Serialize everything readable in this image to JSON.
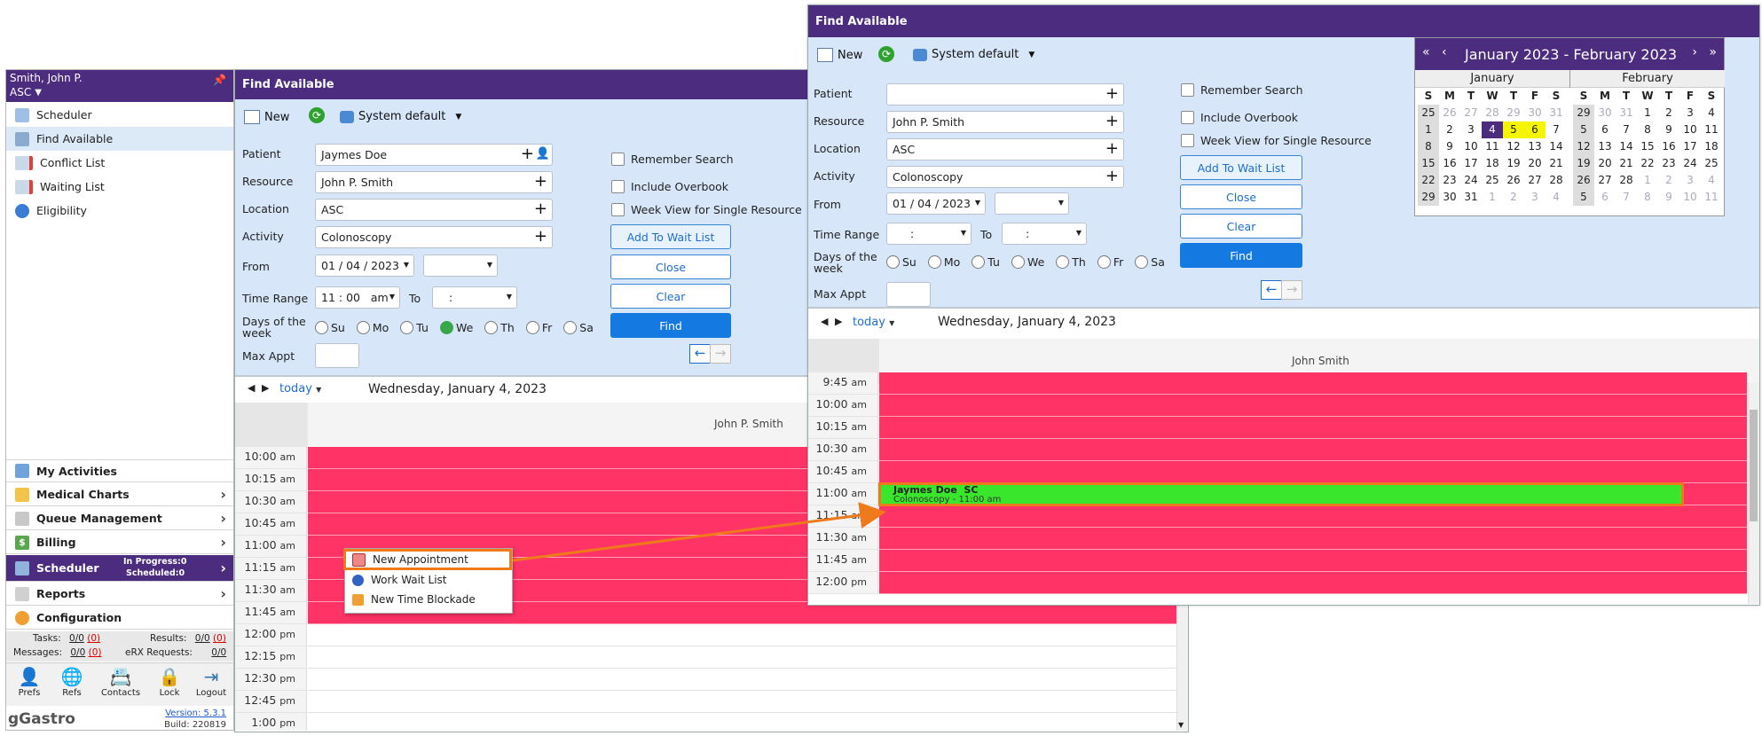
{
  "sidebar": {
    "user_name": "Smith, John P.",
    "facility": "ASC",
    "nav": [
      "Scheduler",
      "Find Available",
      "Conflict List",
      "Waiting List",
      "Eligibility"
    ],
    "modules": [
      {
        "label": "My Activities",
        "has_chevron": false
      },
      {
        "label": "Medical Charts",
        "has_chevron": true
      },
      {
        "label": "Queue Management",
        "has_chevron": true
      },
      {
        "label": "Billing",
        "has_chevron": true
      },
      {
        "label": "Scheduler",
        "has_chevron": true,
        "in_progress": "In Progress:0",
        "scheduled": "Scheduled:0"
      },
      {
        "label": "Reports",
        "has_chevron": true
      },
      {
        "label": "Configuration",
        "has_chevron": false
      }
    ],
    "stats": {
      "tasks_label": "Tasks:",
      "tasks_value": "0/0",
      "tasks_red": "(0)",
      "results_label": "Results:",
      "results_value": "0/0",
      "results_red": "(0)",
      "messages_label": "Messages:",
      "messages_value": "0/0",
      "messages_red": "(0)",
      "erx_label": "eRX Requests:",
      "erx_value": "0/0"
    },
    "footer_buttons": [
      "Prefs",
      "Refs",
      "Contacts",
      "Lock",
      "Logout"
    ],
    "brand": "gGastro",
    "version": "Version: 5.3.1",
    "build": "Build: 220819"
  },
  "left_window": {
    "title": "Find Available",
    "toolbar": {
      "new": "New",
      "system_default": "System default"
    },
    "labels": {
      "patient": "Patient",
      "resource": "Resource",
      "location": "Location",
      "activity": "Activity",
      "from": "From",
      "time_range": "Time Range",
      "to": "To",
      "days_line1": "Days of the",
      "days_line2": "week",
      "max_appt": "Max Appt"
    },
    "values": {
      "patient": "Jaymes Doe",
      "resource": "John P. Smith",
      "location": "ASC",
      "activity": "Colonoscopy",
      "from_date": "01 / 04 / 2023",
      "time_from": "11 : 00   am",
      "time_to": ":"
    },
    "checks": [
      "Remember Search",
      "Include Overbook",
      "Week View for Single Resource"
    ],
    "buttons": {
      "wait_list": "Add To Wait List",
      "close": "Close",
      "clear": "Clear",
      "find": "Find"
    },
    "days": [
      "Su",
      "Mo",
      "Tu",
      "We",
      "Th",
      "Fr",
      "Sa"
    ],
    "checked_day": "We",
    "cal_nav": {
      "today": "today",
      "date": "Wednesday, January 4, 2023"
    },
    "resource_col": "John P. Smith",
    "times": [
      {
        "t": "10:00",
        "ap": "am",
        "busy": true
      },
      {
        "t": "10:15",
        "ap": "am",
        "busy": true
      },
      {
        "t": "10:30",
        "ap": "am",
        "busy": true
      },
      {
        "t": "10:45",
        "ap": "am",
        "busy": true
      },
      {
        "t": "11:00",
        "ap": "am",
        "busy": true
      },
      {
        "t": "11:15",
        "ap": "am",
        "busy": true
      },
      {
        "t": "11:30",
        "ap": "am",
        "busy": true
      },
      {
        "t": "11:45",
        "ap": "am",
        "busy": true
      },
      {
        "t": "12:00",
        "ap": "pm",
        "busy": false
      },
      {
        "t": "12:15",
        "ap": "pm",
        "busy": false
      },
      {
        "t": "12:30",
        "ap": "pm",
        "busy": false
      },
      {
        "t": "12:45",
        "ap": "pm",
        "busy": false
      },
      {
        "t": "1:00",
        "ap": "pm",
        "busy": false
      }
    ],
    "context_menu": [
      "New Appointment",
      "Work Wait List",
      "New Time Blockade"
    ]
  },
  "right_window": {
    "title": "Find Available",
    "toolbar": {
      "new": "New",
      "system_default": "System default"
    },
    "labels": {
      "patient": "Patient",
      "resource": "Resource",
      "location": "Location",
      "activity": "Activity",
      "from": "From",
      "time_range": "Time Range",
      "to": "To",
      "days_line1": "Days of the",
      "days_line2": "week",
      "max_appt": "Max Appt"
    },
    "values": {
      "patient": "",
      "resource": "John P. Smith",
      "location": "ASC",
      "activity": "Colonoscopy",
      "from_date": "01 / 04 / 2023",
      "time_from": ":",
      "time_to": ":"
    },
    "checks": [
      "Remember Search",
      "Include Overbook",
      "Week View for Single Resource"
    ],
    "buttons": {
      "wait_list": "Add To Wait List",
      "close": "Close",
      "clear": "Clear",
      "find": "Find"
    },
    "days": [
      "Su",
      "Mo",
      "Tu",
      "We",
      "Th",
      "Fr",
      "Sa"
    ],
    "cal_nav": {
      "today": "today",
      "date": "Wednesday, January 4, 2023"
    },
    "resource_col": "John Smith",
    "times": [
      {
        "t": "9:45",
        "ap": "am"
      },
      {
        "t": "10:00",
        "ap": "am"
      },
      {
        "t": "10:15",
        "ap": "am"
      },
      {
        "t": "10:30",
        "ap": "am"
      },
      {
        "t": "10:45",
        "ap": "am"
      },
      {
        "t": "11:00",
        "ap": "am"
      },
      {
        "t": "11:15",
        "ap": "am"
      },
      {
        "t": "11:30",
        "ap": "am"
      },
      {
        "t": "11:45",
        "ap": "am"
      },
      {
        "t": "12:00",
        "ap": "pm"
      }
    ],
    "appointment": {
      "name": "Jaymes Doe  SC",
      "detail": "Colonoscopy - 11:00 am"
    },
    "mini_calendar": {
      "range_title": "January 2023 - February 2023",
      "weekday_headers": [
        "S",
        "M",
        "T",
        "W",
        "T",
        "F",
        "S"
      ],
      "months": [
        {
          "name": "January",
          "weeks": [
            {
              "wk": "25",
              "days": [
                "26",
                "27",
                "28",
                "29",
                "30",
                "31"
              ]
            },
            {
              "wk": "1",
              "days": [
                "2",
                "3",
                "4",
                "5",
                "6",
                "7"
              ]
            },
            {
              "wk": "8",
              "days": [
                "9",
                "10",
                "11",
                "12",
                "13",
                "14"
              ]
            },
            {
              "wk": "15",
              "days": [
                "16",
                "17",
                "18",
                "19",
                "20",
                "21"
              ]
            },
            {
              "wk": "22",
              "days": [
                "23",
                "24",
                "25",
                "26",
                "27",
                "28"
              ]
            },
            {
              "wk": "29",
              "days": [
                "30",
                "31",
                "1",
                "2",
                "3",
                "4"
              ]
            }
          ]
        },
        {
          "name": "February",
          "weeks": [
            {
              "wk": "29",
              "days": [
                "30",
                "31",
                "1",
                "2",
                "3",
                "4"
              ]
            },
            {
              "wk": "5",
              "days": [
                "6",
                "7",
                "8",
                "9",
                "10",
                "11"
              ]
            },
            {
              "wk": "12",
              "days": [
                "13",
                "14",
                "15",
                "16",
                "17",
                "18"
              ]
            },
            {
              "wk": "19",
              "days": [
                "20",
                "21",
                "22",
                "23",
                "24",
                "25"
              ]
            },
            {
              "wk": "26",
              "days": [
                "27",
                "28",
                "1",
                "2",
                "3",
                "4"
              ]
            },
            {
              "wk": "5",
              "days": [
                "6",
                "7",
                "8",
                "9",
                "10",
                "11"
              ]
            }
          ]
        }
      ]
    }
  },
  "colors": {
    "brand_purple": "#4b2c7f",
    "busy_slot": "#ff3366",
    "appointment_green": "#39e62b",
    "highlight_orange": "#ee7a1b",
    "selected_day": "#4b2c7f",
    "highlight_day": "#f5f500"
  }
}
